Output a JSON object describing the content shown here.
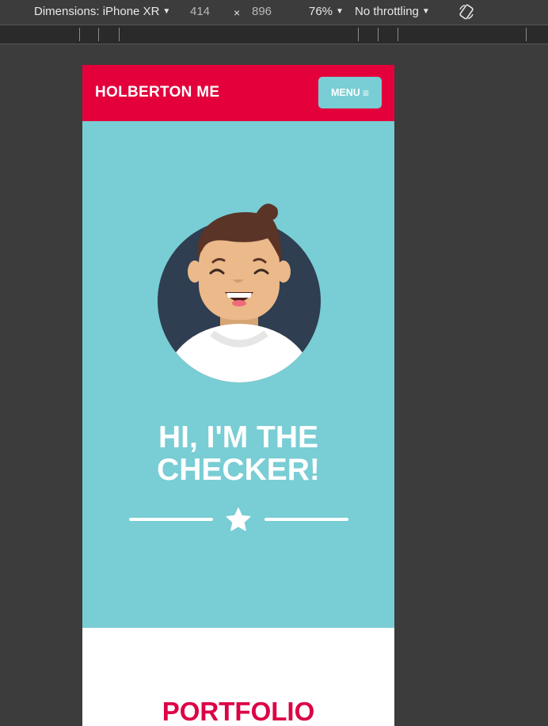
{
  "devtools": {
    "device_label": "Dimensions: iPhone XR",
    "width": "414",
    "times": "×",
    "height": "896",
    "zoom": "76%",
    "throttling": "No throttling",
    "caret": "▼",
    "rotate_icon": "rotate-icon"
  },
  "header": {
    "title": "HOLBERTON ME",
    "menu_label": "MENU",
    "menu_icon": "≡"
  },
  "hero": {
    "heading_line1": "HI, I'M THE",
    "heading_line2": "CHECKER!",
    "avatar_icon": "avatar",
    "star_icon": "star-icon"
  },
  "portfolio": {
    "title": "PORTFOLIO"
  },
  "colors": {
    "header_bg": "#e3003b",
    "hero_bg": "#79cdd4",
    "menu_bg": "#79cdd4",
    "portfolio_title": "#dc0045"
  }
}
